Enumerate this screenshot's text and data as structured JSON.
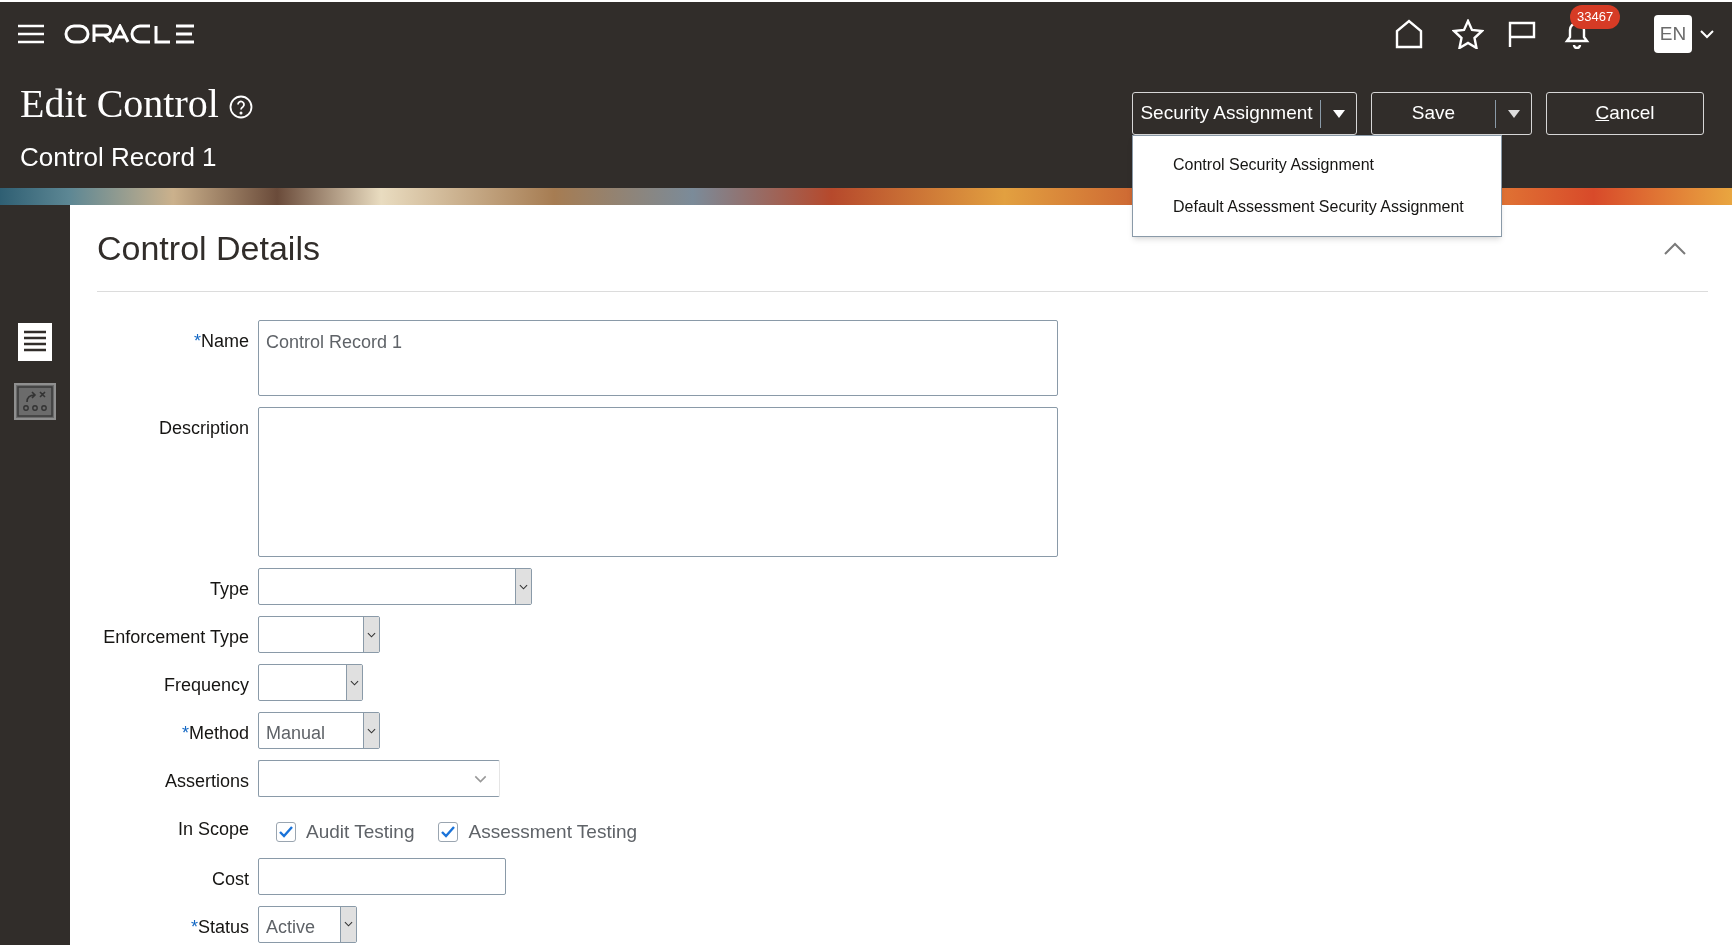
{
  "header": {
    "notification_count": "33467",
    "language": "EN"
  },
  "page": {
    "title": "Edit Control",
    "subtitle": "Control Record 1"
  },
  "actions": [
    {
      "kind": "split",
      "label": "Security Assignment",
      "expanded": true
    },
    {
      "kind": "split",
      "label": "Save",
      "expanded": false
    },
    {
      "kind": "plain",
      "label": "Cancel"
    }
  ],
  "menu": {
    "items": [
      "Control Security Assignment",
      "Default Assessment Security Assignment"
    ]
  },
  "sidebar": {
    "items": [
      {
        "kind": "list",
        "selected": true
      },
      {
        "kind": "tasks",
        "selected": false
      }
    ]
  },
  "section": {
    "title": "Control Details",
    "expanded": true
  },
  "fields": [
    {
      "kind": "textarea",
      "label": "Name",
      "required_mark": "*",
      "value": "Control Record 1"
    },
    {
      "kind": "textarea",
      "label": "Description"
    },
    {
      "kind": "select",
      "label": "Type"
    },
    {
      "kind": "select",
      "label": "Enforcement Type"
    },
    {
      "kind": "select",
      "label": "Frequency"
    },
    {
      "kind": "select",
      "label": "Method",
      "required_mark": "*",
      "value": "Manual"
    },
    {
      "kind": "combobox",
      "label": "Assertions"
    },
    {
      "kind": "checkboxes",
      "label": "In Scope",
      "options": [
        {
          "label": "Audit Testing",
          "checked": true
        },
        {
          "label": "Assessment Testing",
          "checked": true
        }
      ]
    },
    {
      "kind": "text",
      "label": "Cost"
    },
    {
      "kind": "select",
      "label": "Status",
      "required_mark": "*",
      "value": "Active"
    }
  ]
}
